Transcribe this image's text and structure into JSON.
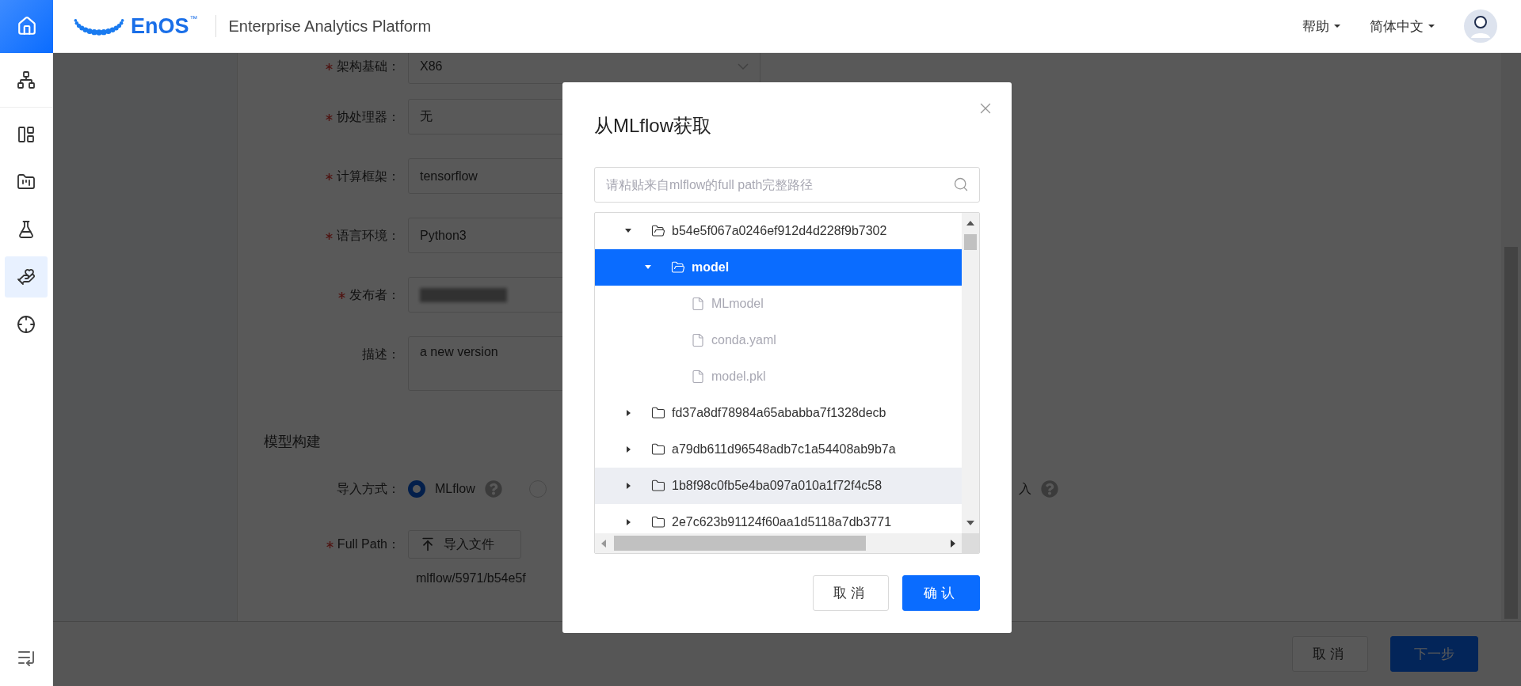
{
  "header": {
    "logo_text": "EnOS",
    "logo_mark": "™",
    "title": "Enterprise Analytics Platform",
    "menus": [
      {
        "label": "帮助"
      },
      {
        "label": "简体中文"
      }
    ]
  },
  "sidebar": {
    "home_selected": true,
    "items": [
      {
        "selected": false
      },
      {
        "selected": false
      },
      {
        "selected": false
      },
      {
        "selected": false
      },
      {
        "selected": true
      },
      {
        "selected": false
      }
    ]
  },
  "form": {
    "fields": [
      {
        "label": "架构基础：",
        "required": true,
        "kind": "select",
        "value": "X86"
      },
      {
        "label": "协处理器：",
        "required": true,
        "kind": "input",
        "value": "无"
      },
      {
        "label": "计算框架：",
        "required": true,
        "kind": "input",
        "value": "tensorflow"
      },
      {
        "label": "语言环境：",
        "required": true,
        "kind": "input",
        "value": "Python3"
      },
      {
        "label": "发布者：",
        "required": true,
        "kind": "redacted"
      },
      {
        "label": "描述：",
        "required": false,
        "kind": "textarea",
        "value": "a new version"
      }
    ],
    "section_title": "模型构建",
    "import": {
      "label": "导入方式：",
      "options": [
        {
          "label": "MLflow",
          "selected": true,
          "help": true
        },
        {
          "selected": false
        }
      ],
      "partial_option": {
        "label": "入",
        "help": true
      }
    },
    "full_path": {
      "label": "Full Path：",
      "required": true,
      "button": "导入文件",
      "value": "mlflow/5971/b54e5f"
    }
  },
  "footer": {
    "cancel": "取消",
    "next": "下一步"
  },
  "modal": {
    "title": "从MLflow获取",
    "search": {
      "placeholder": "请粘贴来自mlflow的full path完整路径"
    },
    "tree": [
      {
        "kind": "folder",
        "label": "b54e5f067a0246ef912d4d228f9b7302",
        "expanded": true,
        "selected": false,
        "hovered": false,
        "disabled": false,
        "children": [
          {
            "kind": "folder",
            "label": "model",
            "expanded": true,
            "selected": true,
            "hovered": false,
            "disabled": false,
            "children": [
              {
                "kind": "file",
                "label": "MLmodel",
                "selected": false,
                "hovered": false,
                "disabled": true
              },
              {
                "kind": "file",
                "label": "conda.yaml",
                "selected": false,
                "hovered": false,
                "disabled": true
              },
              {
                "kind": "file",
                "label": "model.pkl",
                "selected": false,
                "hovered": false,
                "disabled": true
              }
            ]
          }
        ]
      },
      {
        "kind": "folder",
        "label": "fd37a8df78984a65ababba7f1328decb",
        "expanded": false,
        "selected": false,
        "hovered": false,
        "disabled": false
      },
      {
        "kind": "folder",
        "label": "a79db611d96548adb7c1a54408ab9b7a",
        "expanded": false,
        "selected": false,
        "hovered": false,
        "disabled": false
      },
      {
        "kind": "folder",
        "label": "1b8f98c0fb5e4ba097a010a1f72f4c58",
        "expanded": false,
        "selected": false,
        "hovered": true,
        "disabled": false
      },
      {
        "kind": "folder",
        "label": "2e7c623b91124f60aa1d5118a7db3771",
        "expanded": false,
        "selected": false,
        "hovered": false,
        "disabled": false
      }
    ],
    "cancel": "取消",
    "confirm": "确认"
  }
}
